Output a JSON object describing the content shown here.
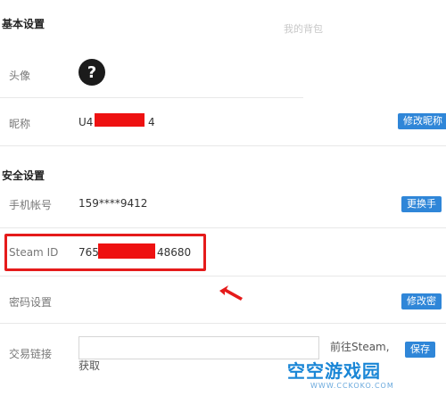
{
  "basic": {
    "title": "基本设置",
    "bag_link": "我的背包",
    "avatar_label": "头像",
    "avatar_glyph": "?",
    "nickname_label": "昵称",
    "nickname_prefix": "U4",
    "nickname_suffix": "4",
    "change_nickname": "修改昵称"
  },
  "security": {
    "title": "安全设置",
    "phone_label": "手机帐号",
    "phone_value": "159****9412",
    "change_phone": "更换手",
    "steam_label": "Steam ID",
    "steam_prefix": "765",
    "steam_suffix": "48680",
    "password_label": "密码设置",
    "change_password": "修改密",
    "trade_label": "交易链接",
    "trade_input_value": "",
    "goto_steam": "前往Steam,",
    "get_text": "获取",
    "trade_button": "保存"
  },
  "watermark": {
    "text": "空空游戏园",
    "sub": "WWW.CCKOKO.COM"
  }
}
